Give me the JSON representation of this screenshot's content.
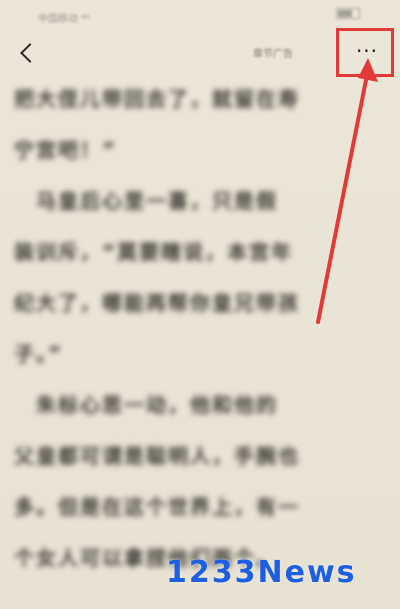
{
  "status_bar": {
    "carrier": "中国移动 ⁴ᴳ"
  },
  "header": {
    "back_icon": "chevron-left-icon",
    "label": "章节广告",
    "more_label": "···"
  },
  "annotation": {
    "box_color": "#e23a36",
    "arrow_color": "#e23a36"
  },
  "content": {
    "lines": [
      "把大侄儿带回去了，就留在寿",
      "宁宫吧！”",
      "　马皇后心里一喜，只是假",
      "装训斥，“莫要瞎说，本宫年",
      "纪大了，哪能再帮你皇兄带孩",
      "子。”",
      "　朱标心思一动，他和他的",
      "父皇都可谓是聪明人，手腕也",
      "多。但是在这个世界上，有一",
      "个女人可以拿捏他们两个。"
    ]
  },
  "watermark": {
    "text": "1233News",
    "color": "#1d5fe0"
  }
}
